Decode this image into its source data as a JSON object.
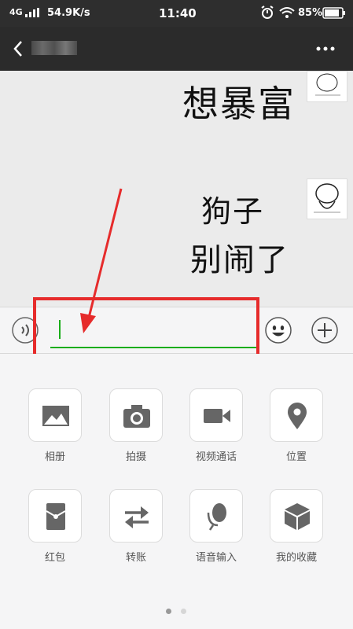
{
  "status_bar": {
    "network": "4G",
    "speed": "54.9K/s",
    "time": "11:40",
    "battery": "85%"
  },
  "nav": {
    "back_icon": "chevron-left-icon",
    "title": "",
    "more_icon": "more-dots-icon"
  },
  "messages": [
    {
      "text": "想暴富",
      "sticker": "doodle-sticker"
    },
    {
      "line1": "狗子",
      "line2": "别闹了",
      "sticker": "doodle-sticker"
    }
  ],
  "input": {
    "value": "",
    "voice_icon": "voice-icon",
    "emoji_icon": "emoji-icon",
    "plus_icon": "plus-icon"
  },
  "panel": {
    "items": [
      {
        "label": "相册",
        "icon": "album-icon"
      },
      {
        "label": "拍摄",
        "icon": "camera-icon"
      },
      {
        "label": "视频通话",
        "icon": "video-call-icon"
      },
      {
        "label": "位置",
        "icon": "location-icon"
      },
      {
        "label": "红包",
        "icon": "red-packet-icon"
      },
      {
        "label": "转账",
        "icon": "transfer-icon"
      },
      {
        "label": "语音输入",
        "icon": "mic-icon"
      },
      {
        "label": "我的收藏",
        "icon": "favorites-icon"
      }
    ],
    "page": 1,
    "pages": 2
  },
  "colors": {
    "accent_green": "#1aad19",
    "annotation_red": "#e62b2b",
    "nav_bg": "#2b2b2b"
  }
}
